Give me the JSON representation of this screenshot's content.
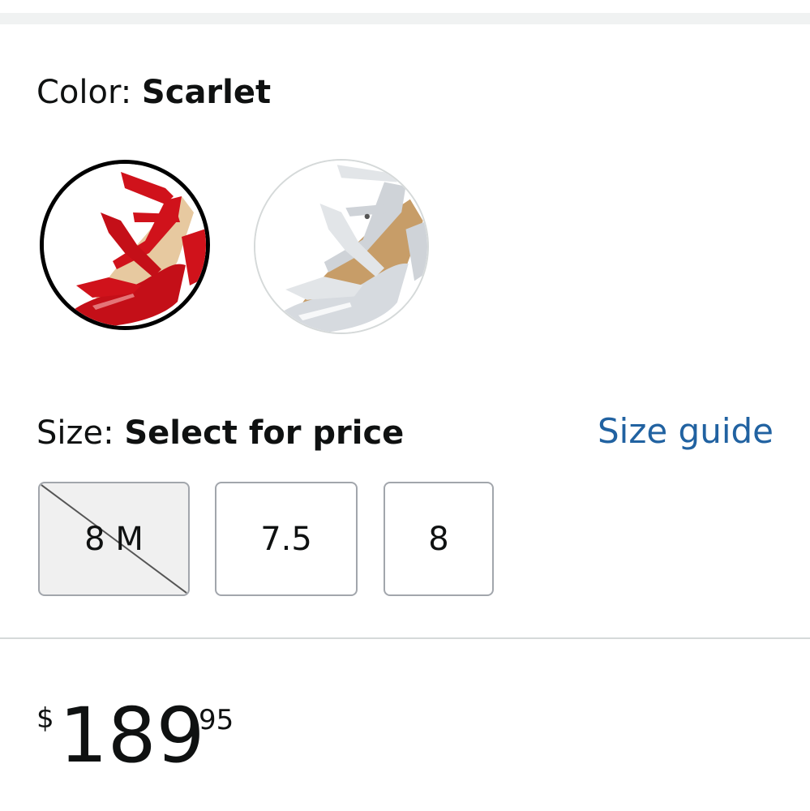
{
  "color": {
    "label": "Color: ",
    "selected": "Scarlet",
    "swatches": [
      {
        "name": "Scarlet",
        "selected": true,
        "shoe_color": "#d0121b"
      },
      {
        "name": "Silver",
        "selected": false,
        "shoe_color": "#cfd3d8"
      }
    ]
  },
  "size": {
    "label": "Size: ",
    "selected": "Select for price",
    "guide_link": "Size guide",
    "options": [
      {
        "label": "8 M",
        "available": false
      },
      {
        "label": "7.5",
        "available": true
      },
      {
        "label": "8",
        "available": true
      }
    ]
  },
  "price": {
    "symbol": "$",
    "whole": "189",
    "fraction": "95"
  },
  "colors": {
    "link": "#2162a1",
    "selected_border": "#000000",
    "option_border": "#a2a6ac",
    "divider": "#d5d9d9"
  }
}
